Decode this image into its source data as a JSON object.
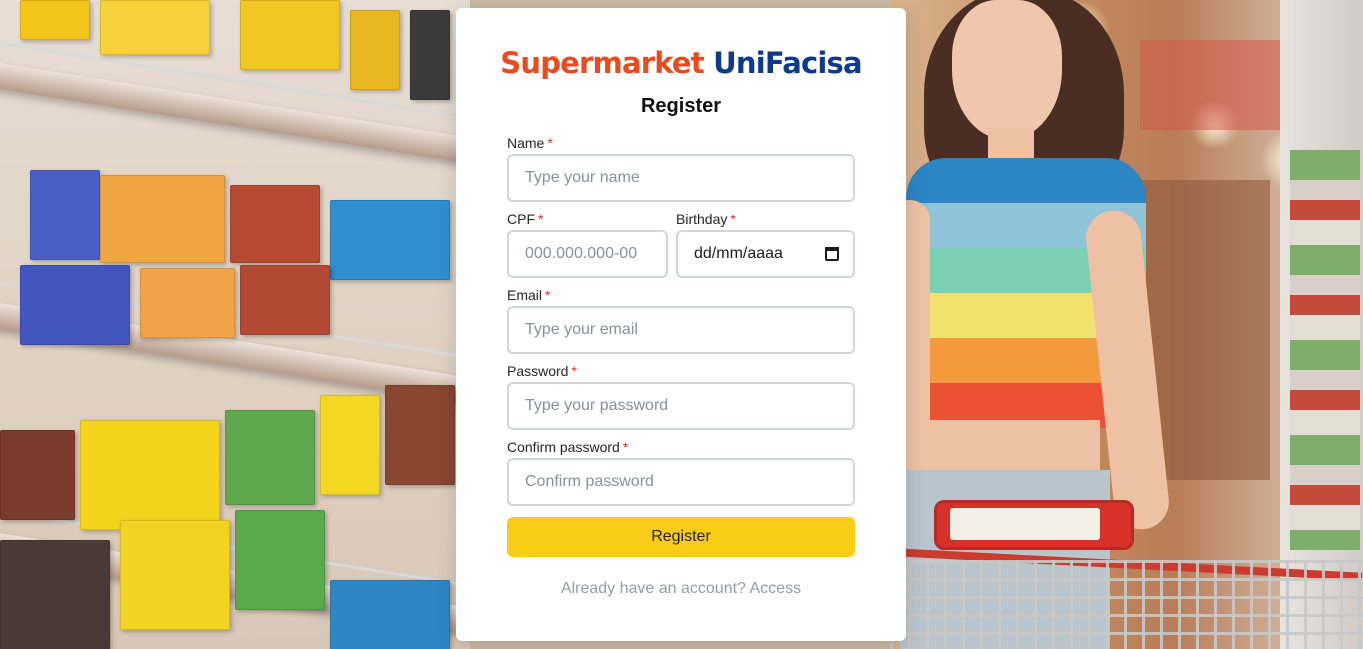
{
  "brand": {
    "part1": "Supermarket",
    "part2": "UniFacisa"
  },
  "form": {
    "title": "Register",
    "fields": {
      "name": {
        "label": "Name",
        "placeholder": "Type your name"
      },
      "cpf": {
        "label": "CPF",
        "placeholder": "000.000.000-00"
      },
      "birthday": {
        "label": "Birthday",
        "value": "dd/mm/aaaa"
      },
      "email": {
        "label": "Email",
        "placeholder": "Type your email"
      },
      "password": {
        "label": "Password",
        "placeholder": "Type your password"
      },
      "confirm": {
        "label": "Confirm password",
        "placeholder": "Confirm password"
      }
    },
    "required_mark": "*",
    "submit_label": "Register",
    "access_text": "Already have an account? Access"
  },
  "colors": {
    "brand_orange": "#ed4a1c",
    "brand_blue": "#0f3a8c",
    "button_yellow": "#f9cc15",
    "required_red": "#e03131"
  }
}
